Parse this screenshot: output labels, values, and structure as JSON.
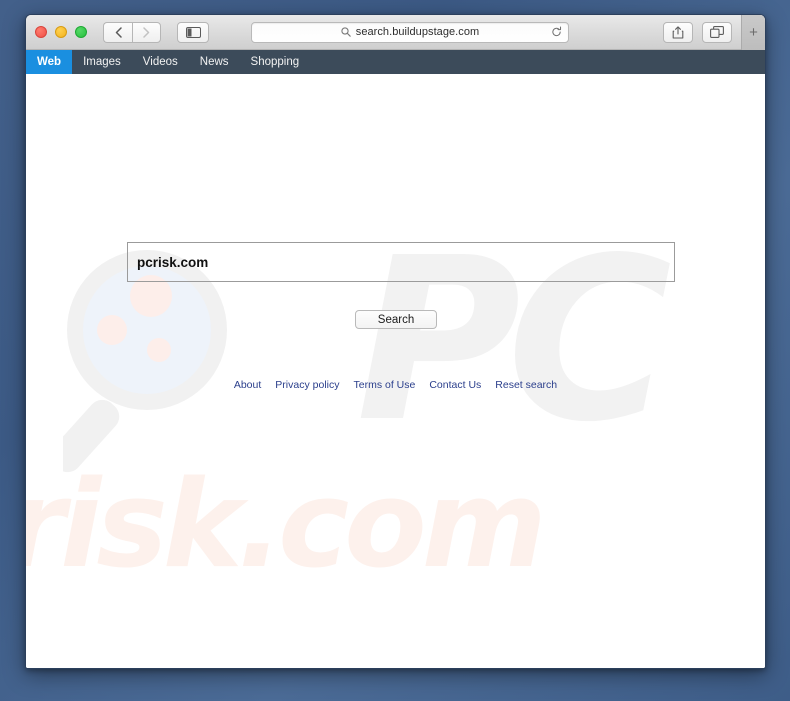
{
  "browser": {
    "traffic_lights": [
      "close",
      "minimize",
      "maximize"
    ],
    "back_label": "‹",
    "forward_label": "›",
    "sidebar_icon": "sidebar-icon",
    "url": "search.buildupstage.com",
    "url_search_icon": "search-icon",
    "reload_icon": "reload-icon",
    "share_icon": "share-icon",
    "tabs_icon": "tabs-overview-icon",
    "newtab_label": "+"
  },
  "site_nav": {
    "items": [
      {
        "label": "Web",
        "active": true
      },
      {
        "label": "Images",
        "active": false
      },
      {
        "label": "Videos",
        "active": false
      },
      {
        "label": "News",
        "active": false
      },
      {
        "label": "Shopping",
        "active": false
      }
    ]
  },
  "search": {
    "query": "pcrisk.com",
    "placeholder": "",
    "button_label": "Search"
  },
  "footer": {
    "links": [
      {
        "label": "About"
      },
      {
        "label": "Privacy policy"
      },
      {
        "label": "Terms of Use"
      },
      {
        "label": "Contact Us"
      },
      {
        "label": "Reset search"
      }
    ]
  },
  "watermark": {
    "pc_text": "PC",
    "risk_text": "risk.com",
    "magnifier_icon": "magnifier-watermark-icon"
  },
  "colors": {
    "nav_bar": "#3c4b5a",
    "nav_active": "#1a8fe0",
    "link": "#2b3f8c",
    "desktop": "#43608a",
    "pc_watermark": "#f2f2f2",
    "risk_watermark": "#fdf1ec"
  }
}
